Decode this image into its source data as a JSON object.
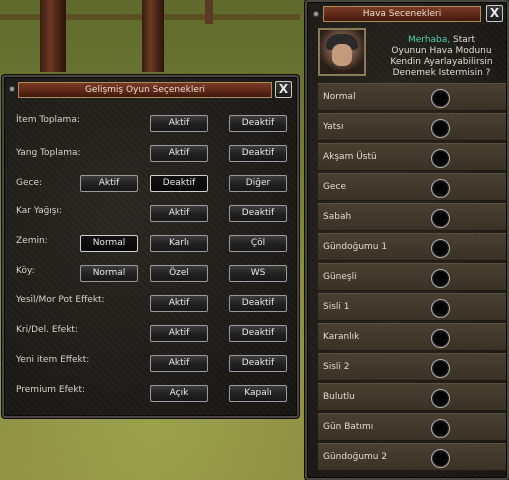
{
  "advanced": {
    "title": "Gelişmiş Oyun Seçenekleri",
    "close": "X",
    "rows": [
      {
        "label": "İtem Toplama:",
        "buttons": [
          "Aktif",
          "Deaktif"
        ]
      },
      {
        "label": "Yang Toplama:",
        "buttons": [
          "Aktif",
          "Deaktif"
        ]
      },
      {
        "label": "Gece:",
        "buttons": [
          "Aktif",
          "Deaktif",
          "Diğer"
        ]
      },
      {
        "label": "Kar Yağışı:",
        "buttons": [
          "Aktif",
          "Deaktif"
        ]
      },
      {
        "label": "Zemin:",
        "buttons": [
          "Normal",
          "Karlı",
          "Çöl"
        ]
      },
      {
        "label": "Köy:",
        "buttons": [
          "Normal",
          "Özel",
          "WS"
        ]
      },
      {
        "label": "Yesil/Mor Pot Effekt:",
        "buttons": [
          "Aktif",
          "Deaktif"
        ]
      },
      {
        "label": "Kri/Del. Efekt:",
        "buttons": [
          "Aktif",
          "Deaktif"
        ]
      },
      {
        "label": "Yeni item Effekt:",
        "buttons": [
          "Aktif",
          "Deaktif"
        ]
      },
      {
        "label": "Premium Efekt:",
        "buttons": [
          "Açık",
          "Kapalı"
        ]
      }
    ]
  },
  "weather": {
    "title": "Hava Secenekleri",
    "close": "X",
    "greeting_hi": "Merhaba,",
    "greeting_line1": "Start",
    "greeting_line2": "Oyunun Hava Modunu",
    "greeting_line3": "Kendin Ayarlayabilirsin",
    "greeting_line4": "Denemek Istermisin ?",
    "options": [
      "Normal",
      "Yatsı",
      "Akşam Üstü",
      "Gece",
      "Sabah",
      "Gündoğumu 1",
      "Güneşli",
      "Sisli 1",
      "Karanlık",
      "Sisli 2",
      "Bulutlu",
      "Gün Batımı",
      "Gündoğumu 2"
    ]
  }
}
